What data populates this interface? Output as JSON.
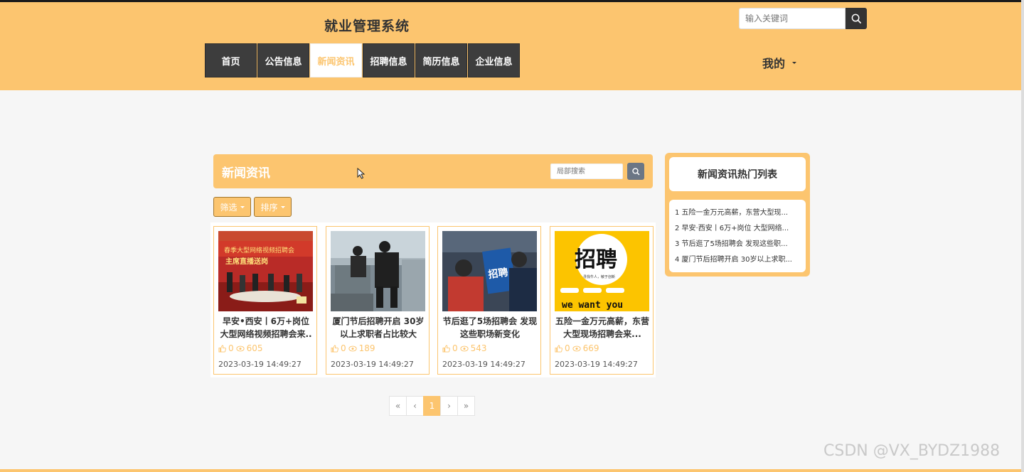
{
  "header": {
    "site_title": "就业管理系统",
    "search_placeholder": "输入关键词",
    "nav": [
      {
        "label": "首页",
        "active": false
      },
      {
        "label": "公告信息",
        "active": false
      },
      {
        "label": "新闻资讯",
        "active": true
      },
      {
        "label": "招聘信息",
        "active": false
      },
      {
        "label": "简历信息",
        "active": false
      },
      {
        "label": "企业信息",
        "active": false
      }
    ],
    "user_menu_label": "我的"
  },
  "main": {
    "section_title": "新闻资讯",
    "local_search_placeholder": "局部搜索",
    "filter_label": "筛选",
    "sort_label": "排序",
    "cards": [
      {
        "title": "早安•西安丨6万+岗位大型网络视频招聘会来..",
        "likes": "0",
        "views": "605",
        "date": "2023-03-19 14:49:27"
      },
      {
        "title": "厦门节后招聘开启 30岁以上求职者占比较大",
        "likes": "0",
        "views": "189",
        "date": "2023-03-19 14:49:27"
      },
      {
        "title": "节后逛了5场招聘会 发现这些职场新变化",
        "likes": "0",
        "views": "543",
        "date": "2023-03-19 14:49:27"
      },
      {
        "title": "五险一金万元高薪，东营大型现场招聘会来...",
        "likes": "0",
        "views": "669",
        "date": "2023-03-19 14:49:27"
      }
    ],
    "card_images": [
      {
        "banner_text": "春季大型网络视频招聘会",
        "sub": "主席直播送岗"
      },
      {},
      {
        "banner_text": "招聘"
      },
      {
        "big_text": "招聘",
        "line1": "寻找牛人，敏于创新",
        "footer": "we want you"
      }
    ],
    "pagination": [
      "«",
      "‹",
      "1",
      "›",
      "»"
    ],
    "current_page": "1"
  },
  "sidebar": {
    "title": "新闻资讯热门列表",
    "items": [
      "1  五险一金万元高薪，东营大型现...",
      "2  早安·西安丨6万+岗位 大型网络...",
      "3  节后逛了5场招聘会 发现这些职...",
      "4  厦门节后招聘开启 30岁以上求职..."
    ]
  },
  "watermark": "CSDN @VX_BYDZ1988",
  "colors": {
    "accent": "#fcc56f",
    "nav_bg": "#3d3d3d"
  }
}
